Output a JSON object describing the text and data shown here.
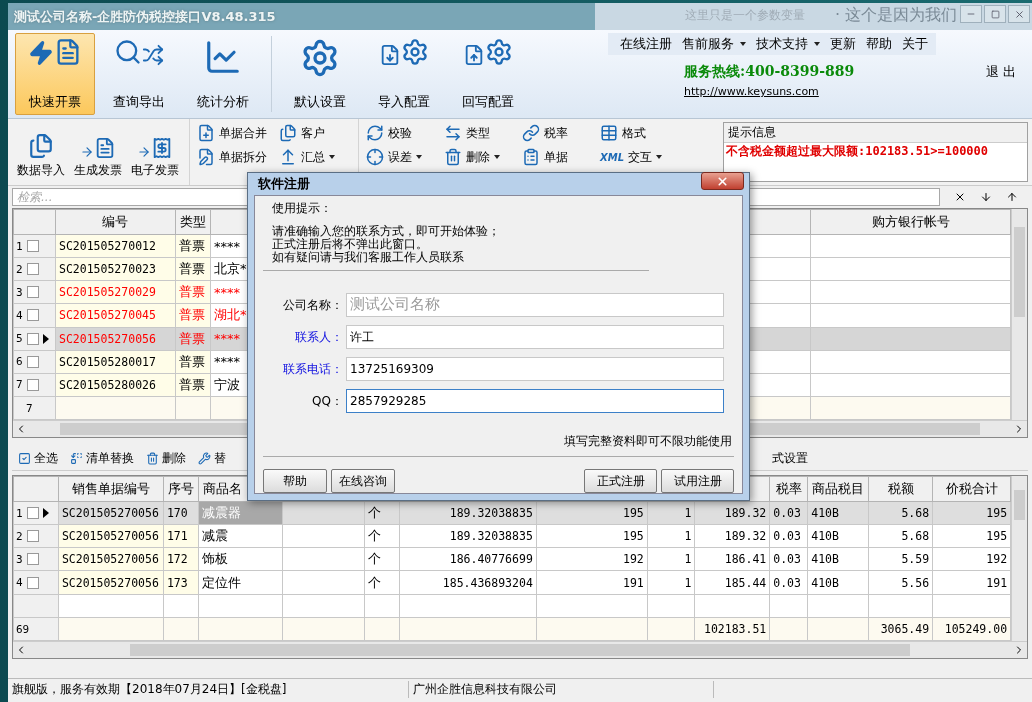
{
  "window": {
    "title": "测试公司名称-企胜防伪税控接口V8.48.315",
    "behind_texts": [
      "这里只是一个参数变量",
      "· 这个是因为我们"
    ]
  },
  "ribbon": {
    "buttons": [
      {
        "label": "快速开票",
        "kind": "quick",
        "selected": true
      },
      {
        "label": "查询导出",
        "kind": "query",
        "selected": false
      },
      {
        "label": "统计分析",
        "kind": "stats",
        "selected": false
      },
      {
        "label": "默认设置",
        "kind": "settings",
        "selected": false
      },
      {
        "label": "导入配置",
        "kind": "import",
        "selected": false
      },
      {
        "label": "回写配置",
        "kind": "writeback",
        "selected": false
      }
    ],
    "menu": [
      {
        "label": "在线注册",
        "dropdown": false
      },
      {
        "label": "售前服务",
        "dropdown": true
      },
      {
        "label": "技术支持",
        "dropdown": true
      },
      {
        "label": "更新",
        "dropdown": false
      },
      {
        "label": "帮助",
        "dropdown": false
      },
      {
        "label": "关于",
        "dropdown": false
      }
    ],
    "hotline": "服务热线:400-8399-889",
    "url": "http://www.keysuns.com",
    "exit": "退 出"
  },
  "toolbar": {
    "large": [
      {
        "label": "数据导入",
        "kind": "import"
      },
      {
        "label": "生成发票",
        "kind": "generate"
      },
      {
        "label": "电子发票",
        "kind": "electronic"
      }
    ],
    "groups": [
      {
        "rows": [
          [
            {
              "label": "单据合并",
              "kind": "merge",
              "dropdown": false
            },
            {
              "label": "客户",
              "kind": "customer",
              "dropdown": false
            }
          ],
          [
            {
              "label": "单据拆分",
              "kind": "split",
              "dropdown": false
            },
            {
              "label": "汇总",
              "kind": "summary",
              "dropdown": true
            }
          ]
        ]
      },
      {
        "rows": [
          [
            {
              "label": "校验",
              "kind": "verify",
              "dropdown": false
            },
            {
              "label": "类型",
              "kind": "type",
              "dropdown": false
            },
            {
              "label": "税率",
              "kind": "rate",
              "dropdown": false
            },
            {
              "label": "格式",
              "kind": "format",
              "dropdown": false
            }
          ],
          [
            {
              "label": "误差",
              "kind": "error",
              "dropdown": true
            },
            {
              "label": "删除",
              "kind": "delete",
              "dropdown": true
            },
            {
              "label": "单据",
              "kind": "doc",
              "dropdown": false
            },
            {
              "label": "交互",
              "kind": "xml",
              "badge": "XML",
              "dropdown": true
            }
          ]
        ]
      }
    ]
  },
  "info_panel": {
    "title": "提示信息",
    "message": "不含税金额超过最大限额:102183.51>=100000"
  },
  "search": {
    "placeholder": "检索..."
  },
  "upper_table": {
    "columns": [
      "编号",
      "类型",
      null,
      "购方银行帐号"
    ],
    "rows": [
      {
        "index": "1",
        "checked": false,
        "selected": false,
        "warning": false,
        "number": "SC201505270012",
        "type": "普票",
        "column_3": "****"
      },
      {
        "index": "2",
        "checked": false,
        "selected": false,
        "warning": false,
        "number": "SC201505270023",
        "type": "普票",
        "column_3": "北京*"
      },
      {
        "index": "3",
        "checked": false,
        "selected": false,
        "warning": true,
        "number": "SC201505270029",
        "type": "普票",
        "column_3": "****"
      },
      {
        "index": "4",
        "checked": false,
        "selected": false,
        "warning": true,
        "number": "SC201505270045",
        "type": "普票",
        "column_3": "湖北*"
      },
      {
        "index": "5",
        "checked": false,
        "selected": true,
        "warning": true,
        "number": "SC201505270056",
        "type": "普票",
        "column_3": "****"
      },
      {
        "index": "6",
        "checked": false,
        "selected": false,
        "warning": false,
        "number": "SC201505280017",
        "type": "普票",
        "column_3": "****"
      },
      {
        "index": "7",
        "checked": false,
        "selected": false,
        "warning": false,
        "number": "SC201505280026",
        "type": "普票",
        "column_3": "宁波"
      }
    ],
    "footer": "7"
  },
  "lower_toolbar": [
    {
      "label": "全选",
      "kind": "select"
    },
    {
      "label": "清单替换",
      "kind": "replace"
    },
    {
      "label": "删除",
      "kind": "delete"
    },
    {
      "label": "替",
      "kind": "tool"
    },
    {
      "label": "式设置",
      "kind": "none"
    }
  ],
  "lower_table": {
    "columns": [
      "销售单据编号",
      "序号",
      "商品名",
      null,
      null,
      null,
      null,
      null,
      null,
      "税率",
      "商品税目",
      "税额",
      "价税合计"
    ],
    "rows": [
      {
        "index": "1",
        "checked": false,
        "selected": true,
        "cells": [
          "SC201505270056",
          "170",
          "减震器",
          null,
          "个",
          "189.32038835",
          "195",
          "1",
          "189.32",
          "0.03",
          "410B",
          "5.68",
          "195"
        ]
      },
      {
        "index": "2",
        "checked": false,
        "selected": false,
        "cells": [
          "SC201505270056",
          "171",
          "减震",
          null,
          "个",
          "189.32038835",
          "195",
          "1",
          "189.32",
          "0.03",
          "410B",
          "5.68",
          "195"
        ]
      },
      {
        "index": "3",
        "checked": false,
        "selected": false,
        "cells": [
          "SC201505270056",
          "172",
          "饰板",
          null,
          "个",
          "186.40776699",
          "192",
          "1",
          "186.41",
          "0.03",
          "410B",
          "5.59",
          "192"
        ]
      },
      {
        "index": "4",
        "checked": false,
        "selected": false,
        "cells": [
          "SC201505270056",
          "173",
          "定位件",
          null,
          "个",
          "185.436893204",
          "191",
          "1",
          "185.44",
          "0.03",
          "410B",
          "5.56",
          "191"
        ]
      }
    ],
    "footer": {
      "index": "69",
      "cells": [
        null,
        null,
        null,
        null,
        null,
        null,
        null,
        null,
        "102183.51",
        null,
        null,
        "3065.49",
        "105249.00"
      ]
    }
  },
  "status_bar": [
    "旗舰版，服务有效期【2018年07月24日】[金税盘]",
    "广州企胜信息科技有限公司"
  ],
  "dialog": {
    "title": "软件注册",
    "tips_title": "使用提示：",
    "tips": [
      "请准确输入您的联系方式，即可开始体验；",
      "正式注册后将不弹出此窗口。",
      "如有疑问请与我们客服工作人员联系"
    ],
    "fields": [
      {
        "label": "公司名称：",
        "placeholder": "测试公司名称",
        "required": false,
        "focused": false
      },
      {
        "label": "联系人：",
        "value": "许工",
        "required": true,
        "focused": false
      },
      {
        "label": "联系电话：",
        "value": "13725169309",
        "required": true,
        "focused": false
      },
      {
        "label": "QQ：",
        "value": "2857929285",
        "required": false,
        "focused": true
      }
    ],
    "note": "填写完整资料即可不限功能使用",
    "left_buttons": [
      "帮助",
      "在线咨询"
    ],
    "right_buttons": [
      "正式注册",
      "试用注册"
    ]
  }
}
